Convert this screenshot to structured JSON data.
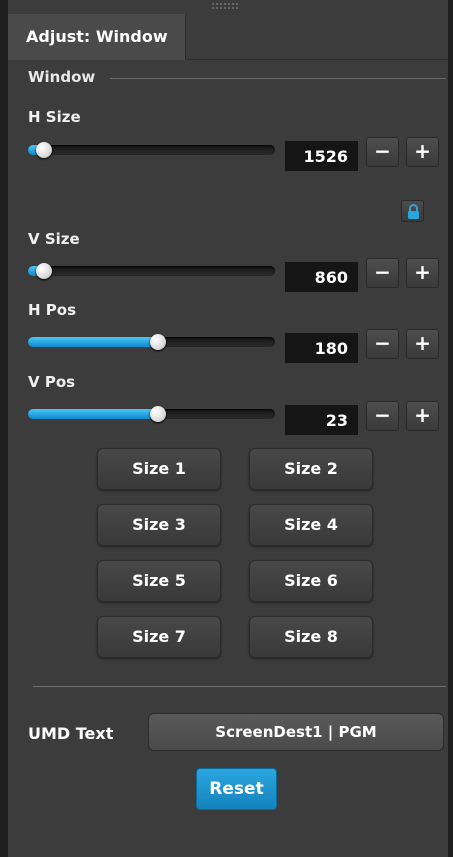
{
  "tab": {
    "title": "Adjust: Window"
  },
  "section": {
    "title": "Window"
  },
  "controls": [
    {
      "label": "H Size",
      "value": "1526",
      "level": 0.05
    },
    {
      "label": "V Size",
      "value": "860",
      "level": 0.05
    },
    {
      "label": "H Pos",
      "value": "180",
      "level": 0.51
    },
    {
      "label": "V Pos",
      "value": "23",
      "level": 0.51
    }
  ],
  "stepper": {
    "minus": "−",
    "plus": "+"
  },
  "lock": {
    "icon": "lock-icon",
    "locked": true
  },
  "sizes": [
    "Size 1",
    "Size 2",
    "Size 3",
    "Size 4",
    "Size 5",
    "Size 6",
    "Size 7",
    "Size 8"
  ],
  "umd": {
    "label": "UMD Text",
    "value": "ScreenDest1 | PGM"
  },
  "reset": {
    "label": "Reset"
  },
  "colors": {
    "accent": "#1a9bd7",
    "panel": "#3c3c3c",
    "valueBox": "#151515"
  }
}
